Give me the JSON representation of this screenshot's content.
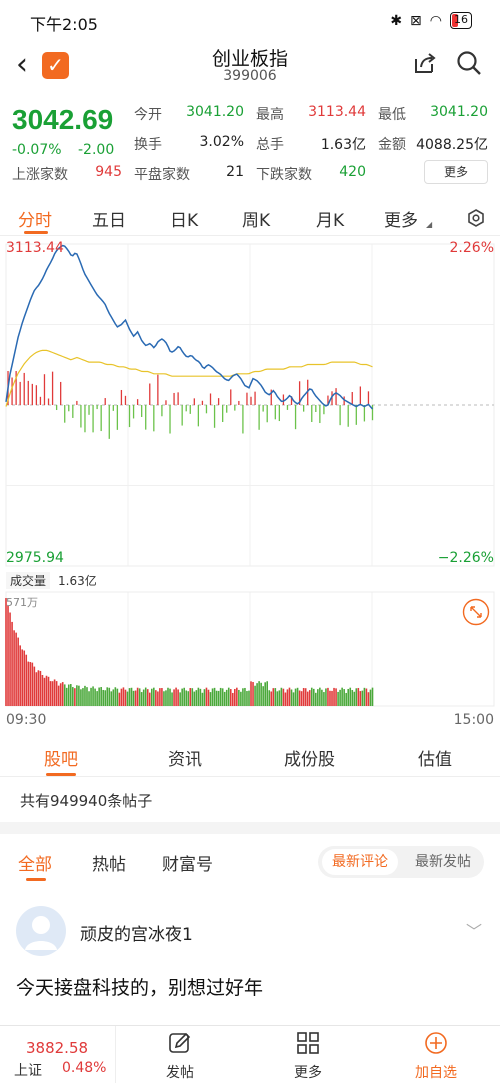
{
  "status": {
    "time": "下午2:05",
    "battery": "16"
  },
  "header": {
    "title": "创业板指",
    "code": "399006"
  },
  "quote": {
    "price": "3042.69",
    "change_pct": "-0.07%",
    "change": "-2.00",
    "up_label": "上涨家数",
    "up_value": "945",
    "open_label": "今开",
    "open_value": "3041.20",
    "high_label": "最高",
    "high_value": "3113.44",
    "low_label": "最低",
    "low_value": "3041.20",
    "turnover_label": "换手",
    "turnover_value": "3.02%",
    "volume_label": "总手",
    "volume_value": "1.63亿",
    "amount_label": "金额",
    "amount_value": "4088.25亿",
    "flat_label": "平盘家数",
    "flat_value": "21",
    "down_label": "下跌家数",
    "down_value": "420",
    "more": "更多"
  },
  "period_tabs": [
    "分时",
    "五日",
    "日K",
    "周K",
    "月K",
    "更多"
  ],
  "chart": {
    "y_top": "3113.44",
    "y_bottom": "2975.94",
    "pct_top": "2.26%",
    "pct_bottom": "−2.26%",
    "vol_label": "成交量",
    "vol_value": "1.63亿",
    "vol_max": "571万",
    "t_start": "09:30",
    "t_end": "15:00"
  },
  "chart_data": {
    "type": "line",
    "title": "",
    "x_range": [
      "09:30",
      "15:00"
    ],
    "ylim": [
      2975.94,
      3113.44
    ],
    "reference_close": 3044.69,
    "series": [],
    "price": [
      3046,
      3058,
      3066,
      3074,
      3080,
      3085,
      3090,
      3094,
      3096,
      3099,
      3103,
      3106,
      3110,
      3112,
      3113,
      3111,
      3108,
      3110,
      3106,
      3101,
      3098,
      3095,
      3092,
      3090,
      3088,
      3084,
      3081,
      3078,
      3079,
      3081,
      3077,
      3074,
      3076,
      3072,
      3070,
      3071,
      3069,
      3072,
      3073,
      3071,
      3067,
      3068,
      3070,
      3067,
      3065,
      3066,
      3064,
      3063,
      3060,
      3062,
      3061,
      3059,
      3058,
      3056,
      3055,
      3057,
      3058,
      3056,
      3053,
      3052,
      3056,
      3055,
      3053,
      3050,
      3049,
      3051,
      3048,
      3046,
      3047,
      3049,
      3046,
      3045,
      3048,
      3050,
      3052,
      3049,
      3047,
      3045,
      3044,
      3048,
      3050,
      3049,
      3047,
      3046,
      3045,
      3044,
      3045,
      3044,
      3045,
      3043
    ],
    "avg_price": [
      3044,
      3052,
      3058,
      3062,
      3065,
      3067,
      3068,
      3068,
      3067,
      3066,
      3065,
      3064,
      3065,
      3064,
      3063,
      3063,
      3063,
      3062,
      3062,
      3061,
      3061,
      3060,
      3060,
      3059,
      3059,
      3058,
      3058,
      3058,
      3057,
      3057,
      3057,
      3057,
      3057,
      3057,
      3057,
      3057,
      3057,
      3057,
      3057,
      3058,
      3058,
      3058,
      3059,
      3059,
      3060,
      3060,
      3060,
      3060,
      3061,
      3061,
      3061,
      3062,
      3062,
      3062,
      3062,
      3063,
      3063,
      3063,
      3063,
      3063,
      3062,
      3062,
      3061
    ]
  },
  "section_tabs": [
    "股吧",
    "资讯",
    "成份股",
    "估值"
  ],
  "post_count": "共有949940条帖子",
  "filter_tabs": [
    "全部",
    "热帖",
    "财富号"
  ],
  "sort": {
    "latest_comment": "最新评论",
    "latest_post": "最新发帖"
  },
  "post": {
    "user": "顽皮的宫冰夜1",
    "text": "今天接盘科技的，别想过好年"
  },
  "bottom_nav": {
    "index_value": "3882.58",
    "index_name": "上证",
    "index_pct": "0.48%",
    "post": "发帖",
    "more": "更多",
    "add": "加自选"
  },
  "colors": {
    "accent": "#f26a21",
    "up": "#e03a3a",
    "down": "#1aa035",
    "price_line": "#2a6ab3",
    "avg_line": "#e8c32a"
  }
}
